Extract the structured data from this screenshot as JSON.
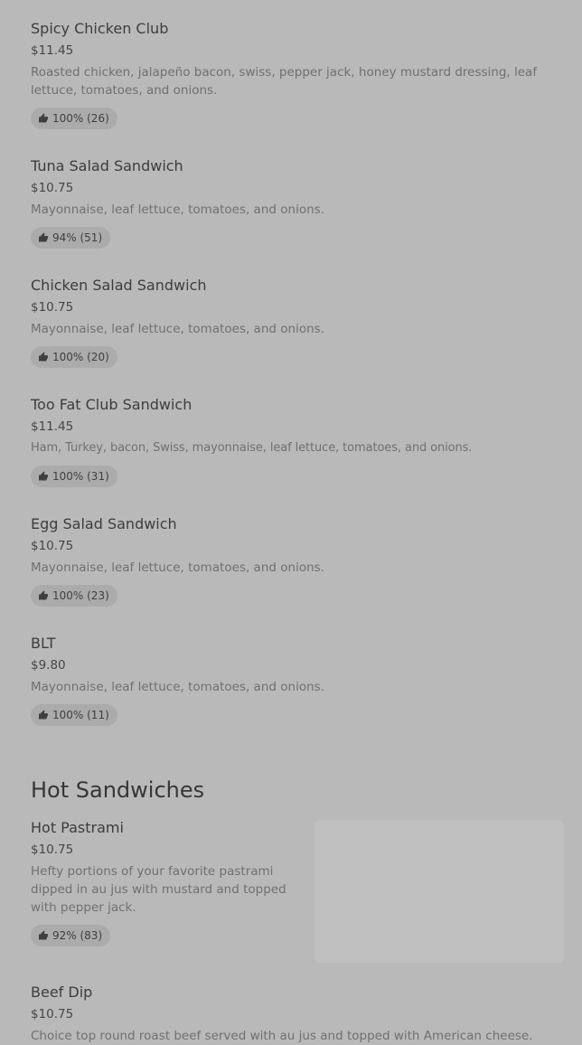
{
  "cold_items": [
    {
      "name": "Spicy Chicken Club",
      "price": "$11.45",
      "description": "Roasted chicken, jalapeño bacon, swiss, pepper jack, honey mustard dressing, leaf lettuce, tomatoes, and onions.",
      "rating": "100% (26)"
    },
    {
      "name": "Tuna Salad Sandwich",
      "price": "$10.75",
      "description": "Mayonnaise, leaf lettuce, tomatoes, and onions.",
      "rating": "94% (51)"
    },
    {
      "name": "Chicken Salad Sandwich",
      "price": "$10.75",
      "description": "Mayonnaise, leaf lettuce, tomatoes, and onions.",
      "rating": "100% (20)"
    },
    {
      "name": "Too Fat Club Sandwich",
      "price": "$11.45",
      "description": "Ham, Turkey, bacon, Swiss, mayonnaise, leaf lettuce, tomatoes, and onions.",
      "rating": "100% (31)"
    },
    {
      "name": "Egg Salad Sandwich",
      "price": "$10.75",
      "description": "Mayonnaise, leaf lettuce, tomatoes, and onions.",
      "rating": "100% (23)"
    },
    {
      "name": "BLT",
      "price": "$9.80",
      "description": "Mayonnaise, leaf lettuce, tomatoes, and onions.",
      "rating": "100% (11)"
    }
  ],
  "hot_section": {
    "title": "Hot Sandwiches",
    "items": [
      {
        "name": "Hot Pastrami",
        "price": "$10.75",
        "description": "Hefty portions of your favorite pastrami dipped in au jus with mustard and topped with pepper jack.",
        "rating": "92% (83)"
      },
      {
        "name": "Beef Dip",
        "price": "$10.75",
        "description": "Choice top round roast beef served with au jus and topped with American cheese."
      }
    ]
  },
  "icons": {
    "rating": "thumbs-up-icon"
  },
  "colors": {
    "background": "#b9b9b9",
    "rating_pill": "#ababab",
    "image_placeholder": "#c0c0c0"
  }
}
